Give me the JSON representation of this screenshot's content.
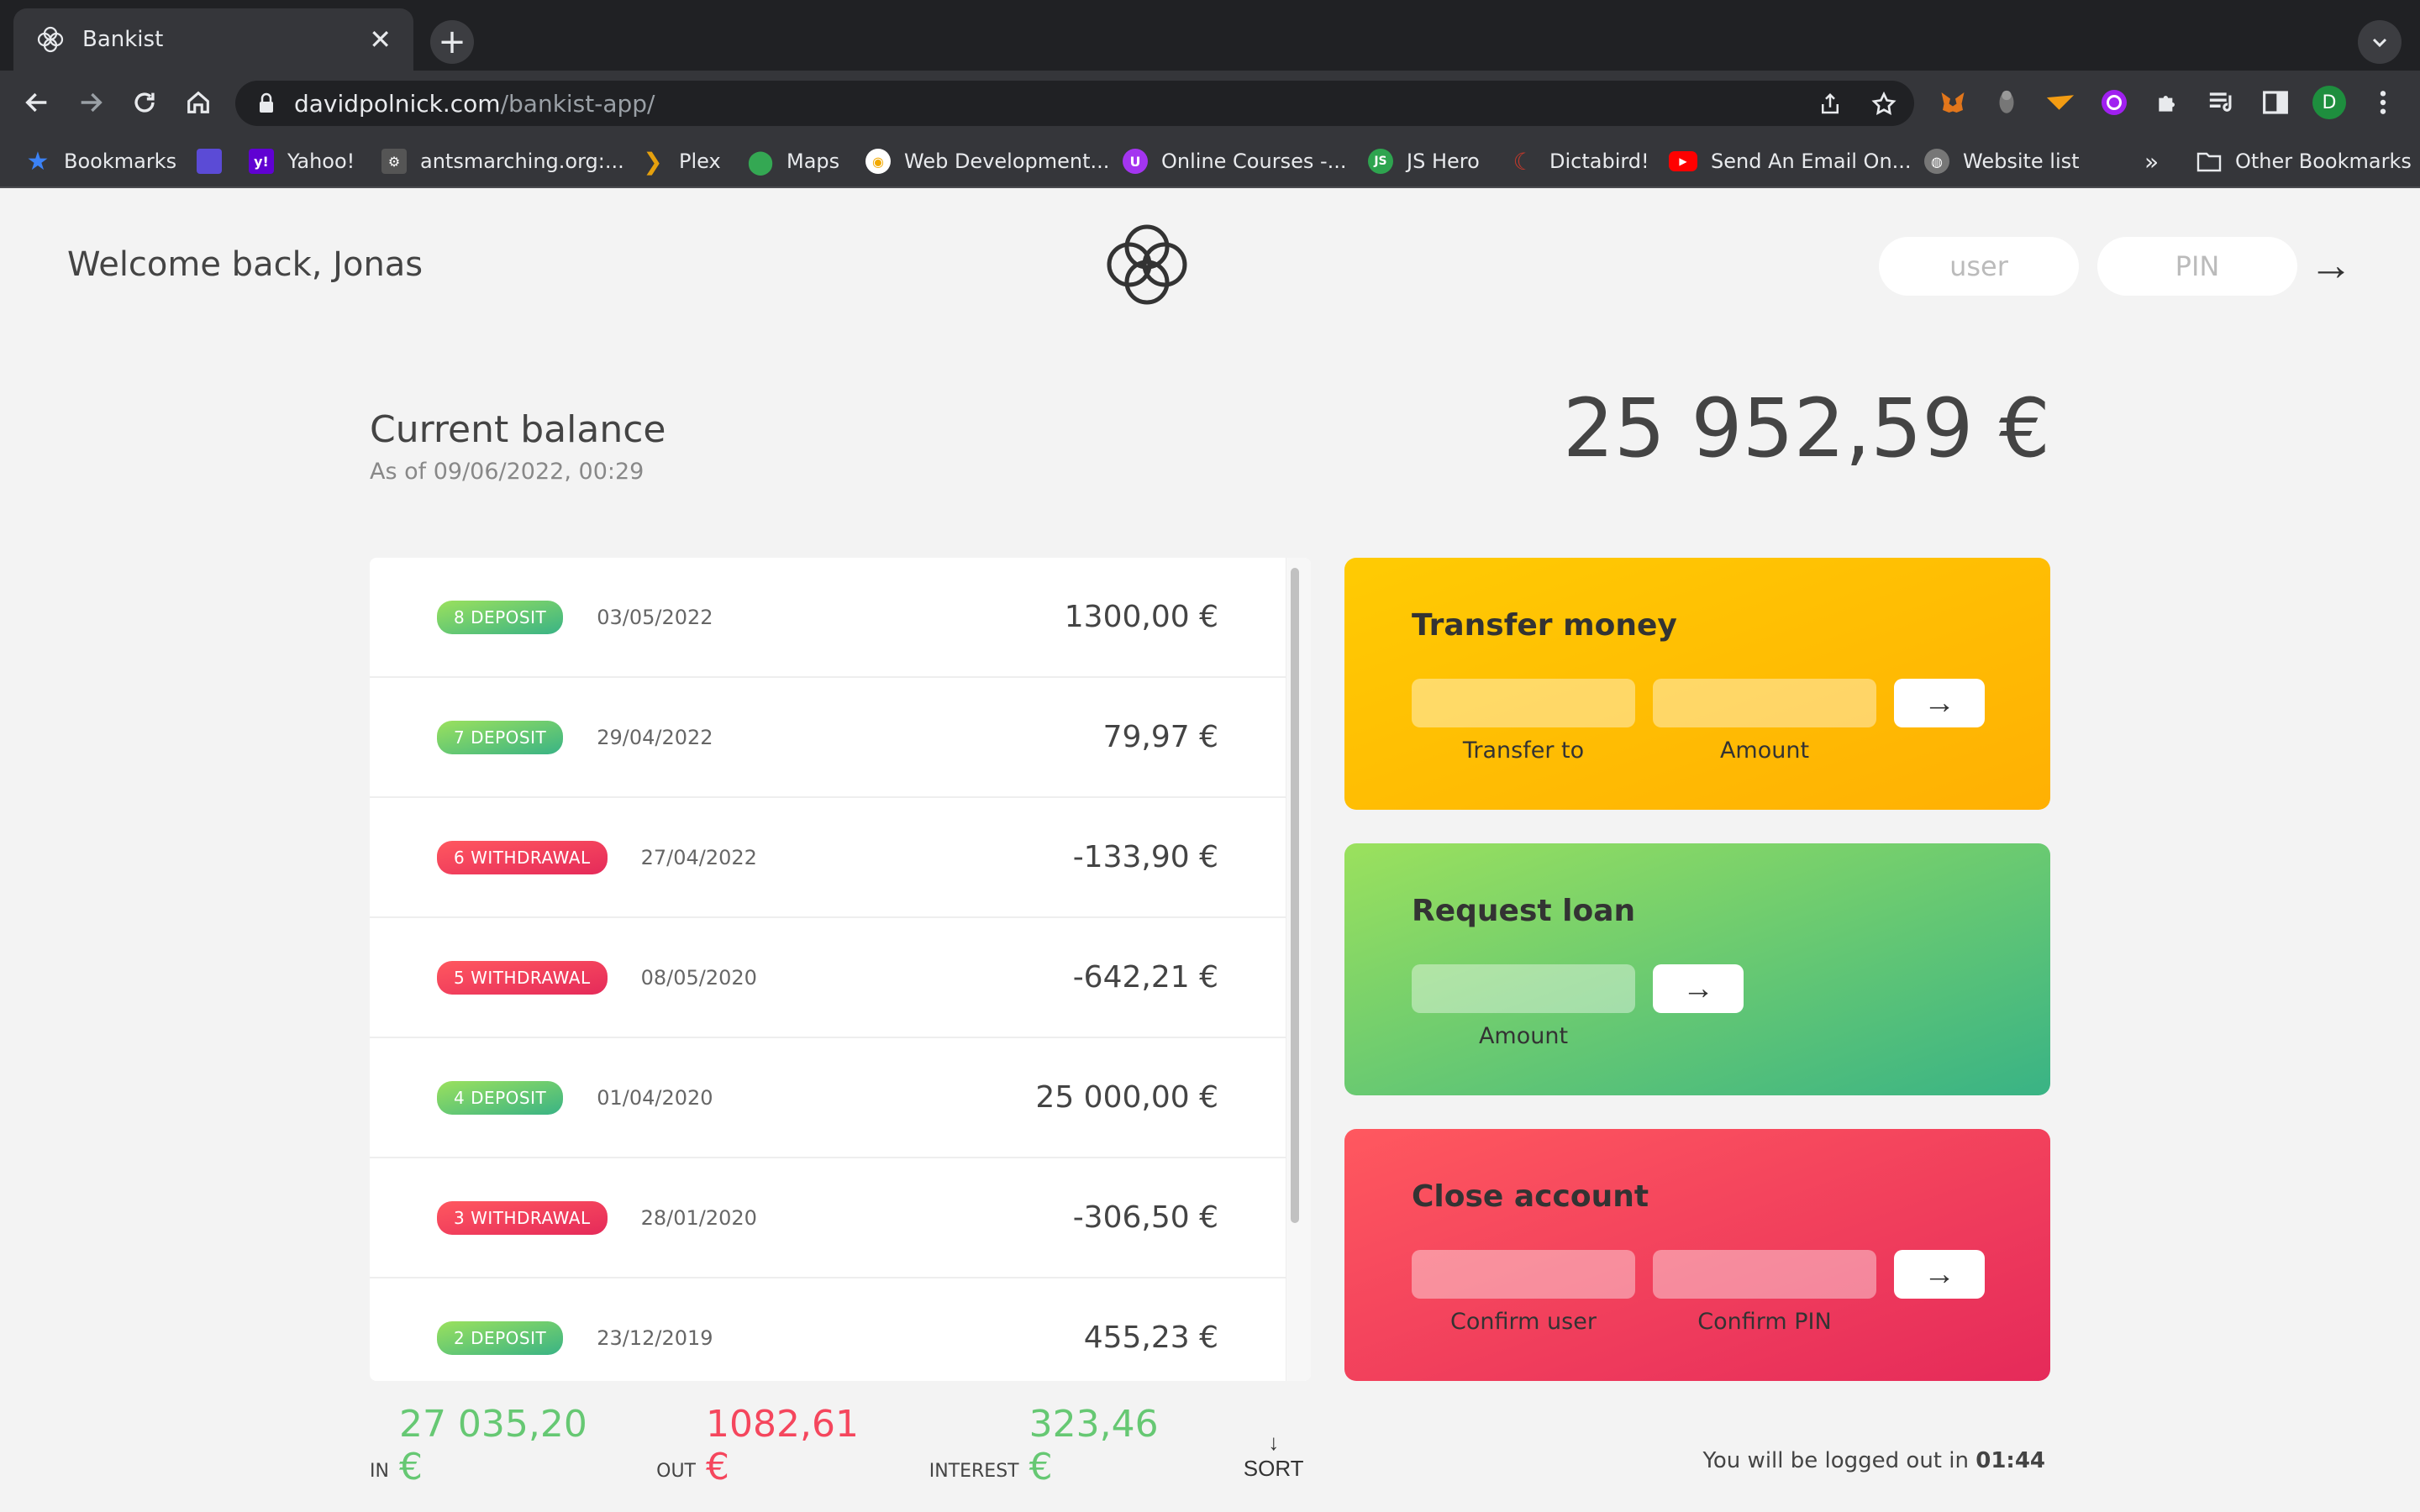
{
  "browser": {
    "tab_title": "Bankist",
    "tab_close": "✕",
    "new_tab": "+",
    "url_host": "davidpolnick.com",
    "url_path": "/bankist-app/",
    "profile_initial": "D"
  },
  "bookmarks": [
    {
      "label": "Bookmarks",
      "icon": "star-icon",
      "color": "#3b82f6"
    },
    {
      "label": "",
      "icon": "app-icon",
      "color": "#5b4bd6"
    },
    {
      "label": "Yahoo!",
      "icon": "yahoo-icon",
      "color": "#6001d2"
    },
    {
      "label": "antsmarching.org:...",
      "icon": "ants-icon",
      "color": "#555"
    },
    {
      "label": "Plex",
      "icon": "plex-icon",
      "color": "#e5a00d"
    },
    {
      "label": "Maps",
      "icon": "maps-icon",
      "color": "#34a853"
    },
    {
      "label": "Web Development...",
      "icon": "webdev-icon",
      "color": "#f2c94c"
    },
    {
      "label": "Online Courses -...",
      "icon": "udemy-icon",
      "color": "#a435f0"
    },
    {
      "label": "JS Hero",
      "icon": "jshero-icon",
      "color": "#2ea44f"
    },
    {
      "label": "Dictabird!",
      "icon": "dictabird-icon",
      "color": "#c0392b"
    },
    {
      "label": "Send An Email On...",
      "icon": "youtube-icon",
      "color": "#ff0000"
    },
    {
      "label": "Website list",
      "icon": "globe-icon",
      "color": "#888"
    }
  ],
  "bookmarks_more": "»",
  "bookmarks_other": "Other Bookmarks",
  "app": {
    "welcome": "Welcome back, Jonas",
    "login_user_placeholder": "user",
    "login_pin_placeholder": "PIN",
    "login_arrow": "→",
    "balance_title": "Current balance",
    "balance_date_prefix": "As of",
    "balance_date": "As of 09/06/2022, 00:29",
    "balance_value": "25 952,59 €"
  },
  "movements": [
    {
      "type_label": "8 deposit",
      "kind": "deposit",
      "date": "03/05/2022",
      "value": "1300,00 €"
    },
    {
      "type_label": "7 deposit",
      "kind": "deposit",
      "date": "29/04/2022",
      "value": "79,97 €"
    },
    {
      "type_label": "6 withdrawal",
      "kind": "withdrawal",
      "date": "27/04/2022",
      "value": "-133,90 €"
    },
    {
      "type_label": "5 withdrawal",
      "kind": "withdrawal",
      "date": "08/05/2020",
      "value": "-642,21 €"
    },
    {
      "type_label": "4 deposit",
      "kind": "deposit",
      "date": "01/04/2020",
      "value": "25 000,00 €"
    },
    {
      "type_label": "3 withdrawal",
      "kind": "withdrawal",
      "date": "28/01/2020",
      "value": "-306,50 €"
    },
    {
      "type_label": "2 deposit",
      "kind": "deposit",
      "date": "23/12/2019",
      "value": "455,23 €"
    }
  ],
  "operations": {
    "transfer": {
      "title": "Transfer money",
      "label_to": "Transfer to",
      "label_amount": "Amount",
      "button": "→"
    },
    "loan": {
      "title": "Request loan",
      "label_amount": "Amount",
      "button": "→"
    },
    "close": {
      "title": "Close account",
      "label_user": "Confirm user",
      "label_pin": "Confirm PIN",
      "button": "→"
    }
  },
  "summary": {
    "in_label": "In",
    "in_value": "27 035,20 €",
    "out_label": "Out",
    "out_value": "1082,61 €",
    "interest_label": "Interest",
    "interest_value": "323,46 €",
    "sort_label": "↓ SORT"
  },
  "logout": {
    "text": "You will be logged out in",
    "timer": "01:44"
  }
}
